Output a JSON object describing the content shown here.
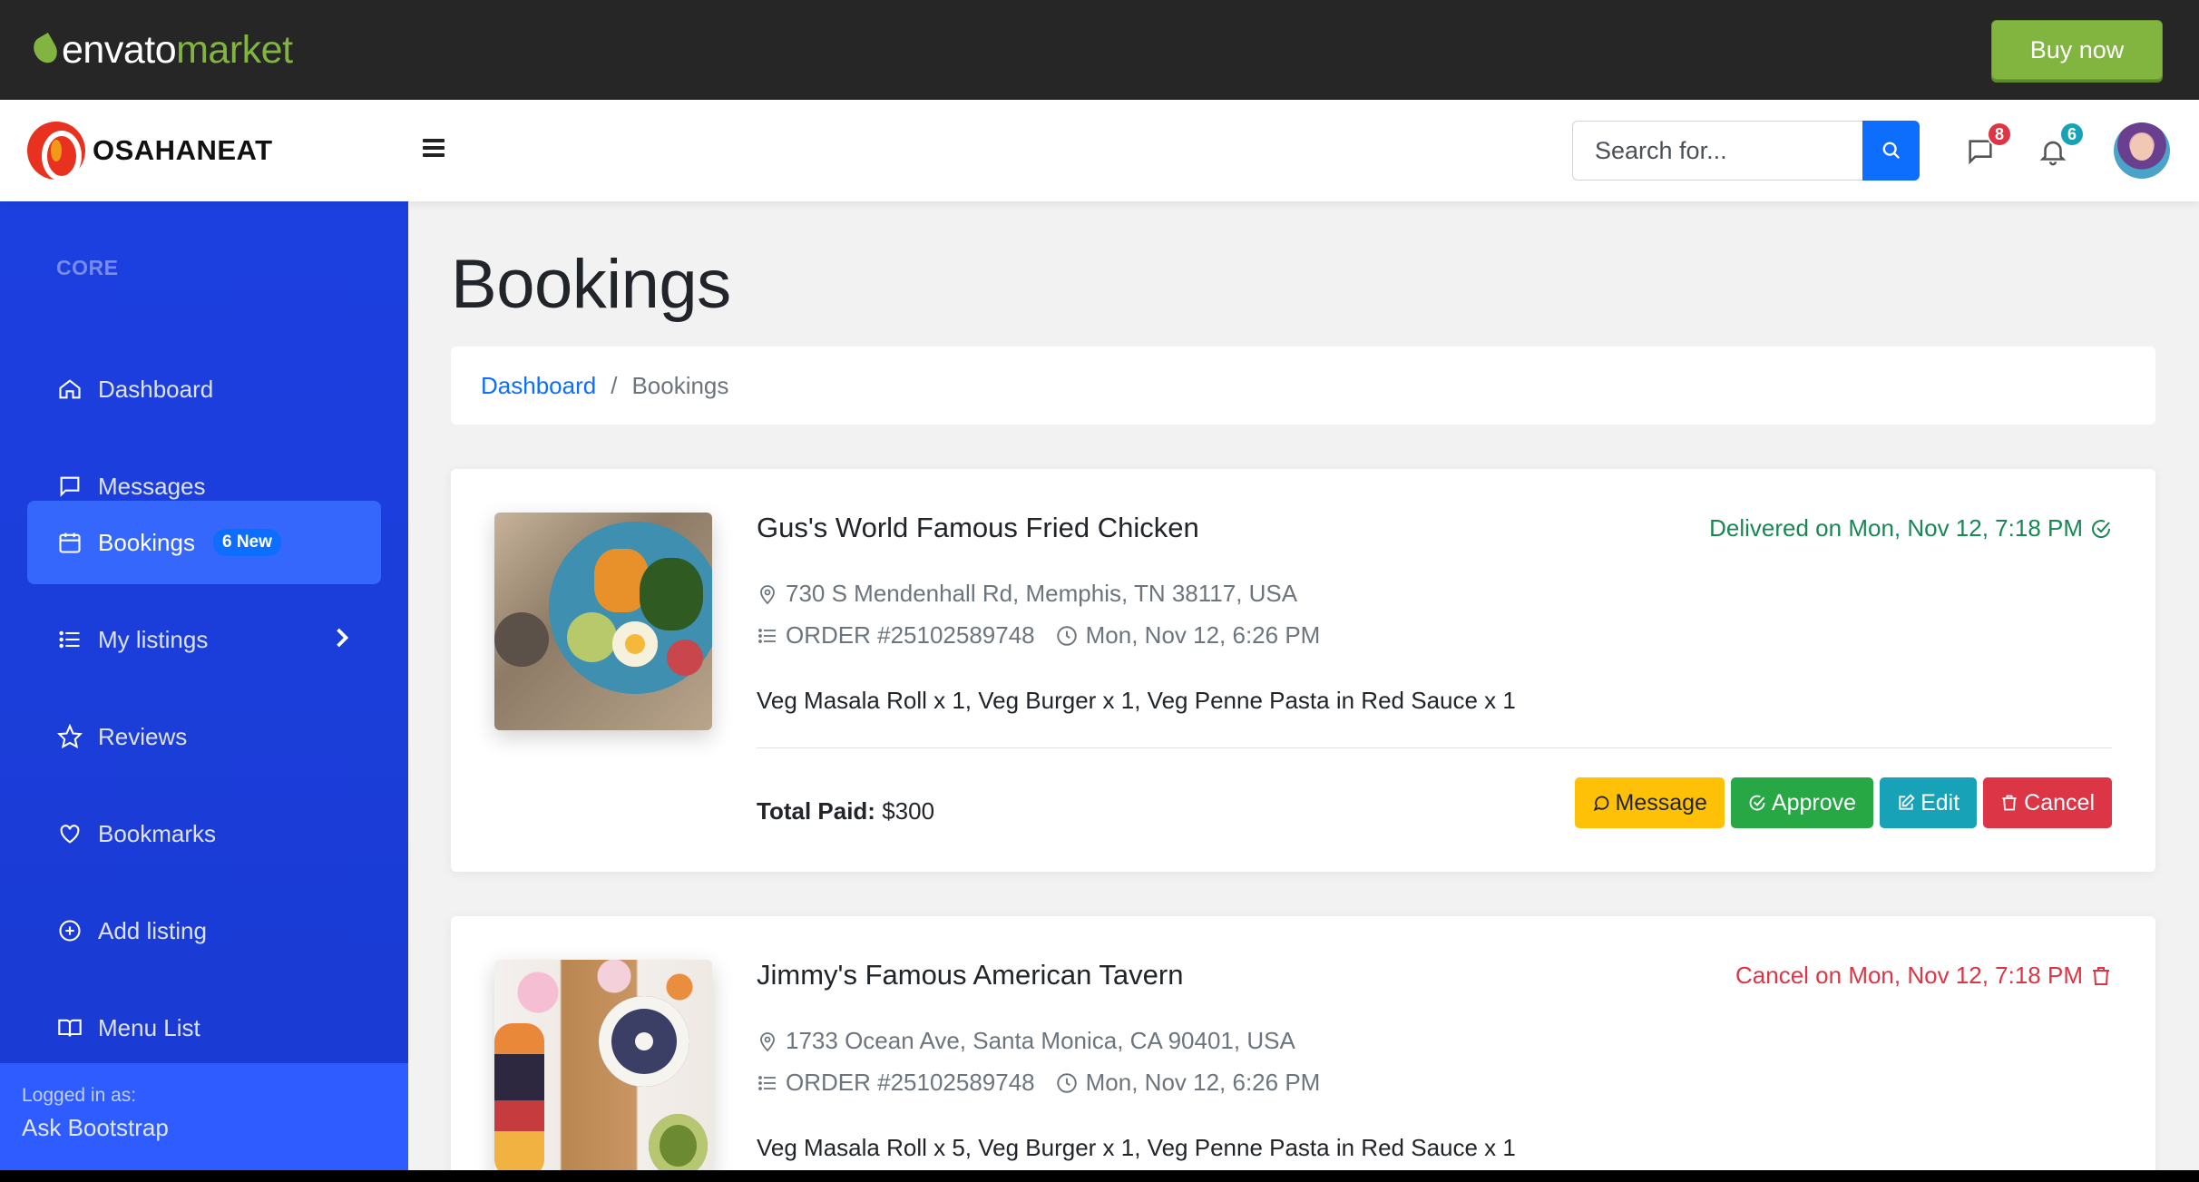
{
  "envato": {
    "logo_envato": "envato",
    "logo_market": "market",
    "buy_label": "Buy now"
  },
  "topnav": {
    "brand": "OSAHANEAT",
    "search_placeholder": "Search for...",
    "messages_count": "8",
    "alerts_count": "6",
    "colors": {
      "primary": "#0d6efd",
      "messages_badge": "#dc3545",
      "alerts_badge": "#17a2b8"
    }
  },
  "sidebar": {
    "heading": "CORE",
    "items": [
      {
        "label": "Dashboard",
        "icon": "home-icon"
      },
      {
        "label": "Messages",
        "icon": "chat-icon"
      },
      {
        "label": "Bookings",
        "icon": "calendar-icon",
        "badge": "6 New",
        "active": true
      },
      {
        "label": "My listings",
        "icon": "list-icon",
        "chevron": true
      },
      {
        "label": "Reviews",
        "icon": "star-icon"
      },
      {
        "label": "Bookmarks",
        "icon": "heart-icon"
      },
      {
        "label": "Add listing",
        "icon": "plus-circle-icon"
      },
      {
        "label": "Menu List",
        "icon": "book-icon"
      }
    ],
    "footer_label": "Logged in as:",
    "footer_user": "Ask Bootstrap"
  },
  "page": {
    "title": "Bookings",
    "breadcrumb": {
      "home": "Dashboard",
      "separator": "/",
      "current": "Bookings"
    }
  },
  "bookings": [
    {
      "name": "Gus's World Famous Fried Chicken",
      "status": "Delivered on Mon, Nov 12, 7:18 PM",
      "address": "730 S Mendenhall Rd, Memphis, TN 38117, USA",
      "order": "ORDER #25102589748",
      "time": "Mon, Nov 12, 6:26 PM",
      "items": "Veg Masala Roll x 1, Veg Burger x 1, Veg Penne Pasta in Red Sauce x 1",
      "total_label": "Total Paid:",
      "total_value": "$300",
      "actions": {
        "message": "Message",
        "approve": "Approve",
        "edit": "Edit",
        "cancel": "Cancel"
      }
    },
    {
      "name": "Jimmy's Famous American Tavern",
      "status": "Cancel on Mon, Nov 12, 7:18 PM",
      "address": "1733 Ocean Ave, Santa Monica, CA 90401, USA",
      "order": "ORDER #25102589748",
      "time": "Mon, Nov 12, 6:26 PM",
      "items": "Veg Masala Roll x 5, Veg Burger x 1, Veg Penne Pasta in Red Sauce x 1"
    }
  ]
}
